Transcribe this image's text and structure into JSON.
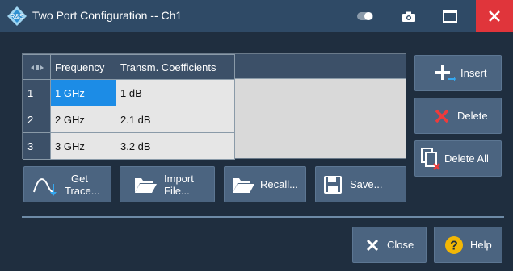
{
  "window": {
    "title": "Two Port Configuration -- Ch1"
  },
  "table": {
    "headers": [
      "Frequency",
      "Transm. Coefficients"
    ],
    "rows": [
      {
        "num": "1",
        "frequency": "1 GHz",
        "coefficient": "1 dB"
      },
      {
        "num": "2",
        "frequency": "2 GHz",
        "coefficient": "2.1 dB"
      },
      {
        "num": "3",
        "frequency": "3 GHz",
        "coefficient": "3.2 dB"
      }
    ]
  },
  "buttons": {
    "insert": "Insert",
    "delete": "Delete",
    "delete_all": "Delete All",
    "get_trace_1": "Get",
    "get_trace_2": "Trace...",
    "import_1": "Import",
    "import_2": "File...",
    "recall": "Recall...",
    "save": "Save...",
    "close": "Close",
    "help": "Help"
  },
  "colors": {
    "titlebar": "#2f4a66",
    "close_red": "#e0353b",
    "selection_blue": "#1c8ce6",
    "button": "#4b6480"
  },
  "icons": [
    "app-logo-icon",
    "toggle-icon",
    "camera-icon",
    "maximize-icon",
    "close-icon",
    "insert-plus-icon",
    "delete-x-icon",
    "delete-all-icon",
    "get-trace-icon",
    "folder-open-icon",
    "save-disk-icon",
    "help-question-icon"
  ]
}
